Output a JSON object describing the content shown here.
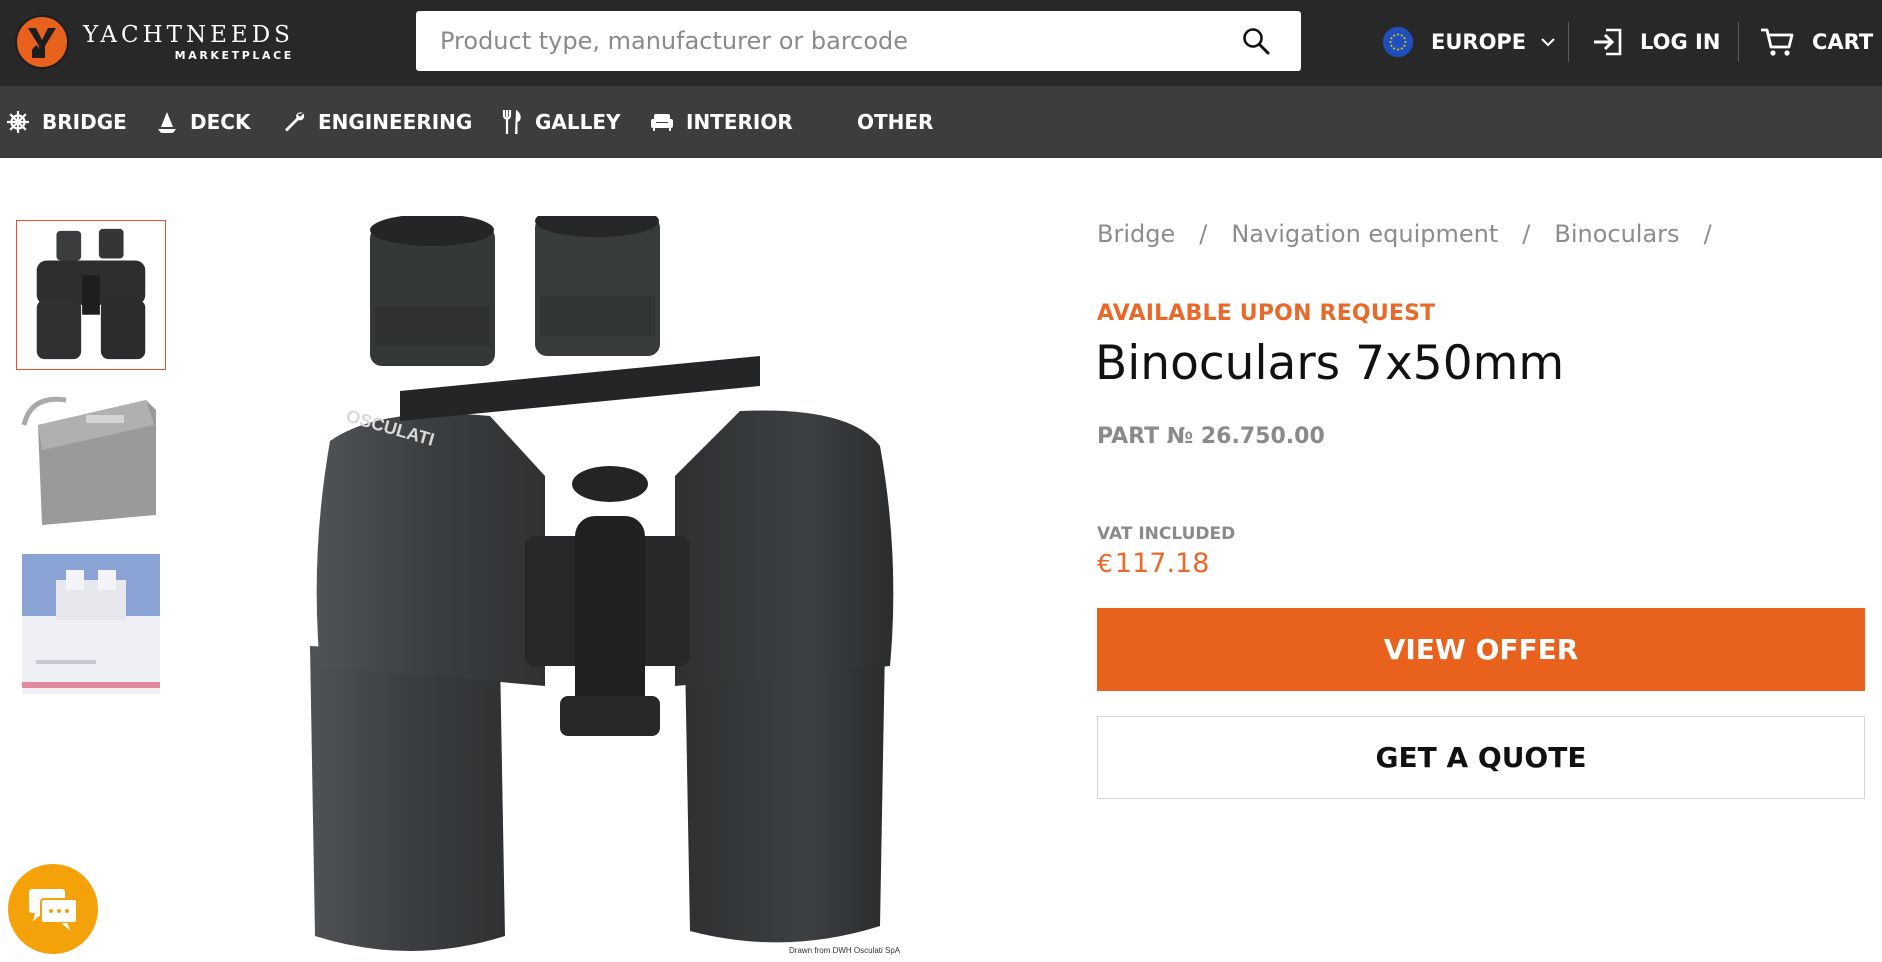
{
  "header": {
    "brand": {
      "name": "YACHTNEEDS",
      "sub": "MARKETPLACE"
    },
    "search": {
      "placeholder": "Product type, manufacturer or barcode",
      "value": ""
    },
    "region": {
      "label": "EUROPE",
      "icon": "eu-flag-icon"
    },
    "login_label": "LOG IN",
    "cart_label": "CART"
  },
  "categories": [
    {
      "label": "BRIDGE",
      "icon": "ship-wheel-icon"
    },
    {
      "label": "DECK",
      "icon": "sail-icon"
    },
    {
      "label": "ENGINEERING",
      "icon": "wrench-icon"
    },
    {
      "label": "GALLEY",
      "icon": "fork-knife-icon"
    },
    {
      "label": "INTERIOR",
      "icon": "sofa-icon"
    },
    {
      "label": "OTHER",
      "icon": ""
    }
  ],
  "gallery": {
    "thumbnails": [
      "binoculars",
      "carrying-bag",
      "box"
    ],
    "active_index": 0,
    "image_credit": "Drawn from DWH Osculati SpA"
  },
  "breadcrumb": [
    "Bridge",
    "Navigation equipment",
    "Binoculars"
  ],
  "product": {
    "availability": "AVAILABLE UPON REQUEST",
    "title": "Binoculars 7x50mm",
    "part_number": "PART № 26.750.00",
    "vat_label": "VAT INCLUDED",
    "currency": "€",
    "price": "117.18",
    "view_offer_label": "VIEW OFFER",
    "quote_label": "GET A QUOTE",
    "brand_print": "OSCULATI"
  },
  "colors": {
    "accent": "#e8621d",
    "topbar": "#282828",
    "navbar": "#3d3d3d",
    "chat": "#f5a20a"
  }
}
